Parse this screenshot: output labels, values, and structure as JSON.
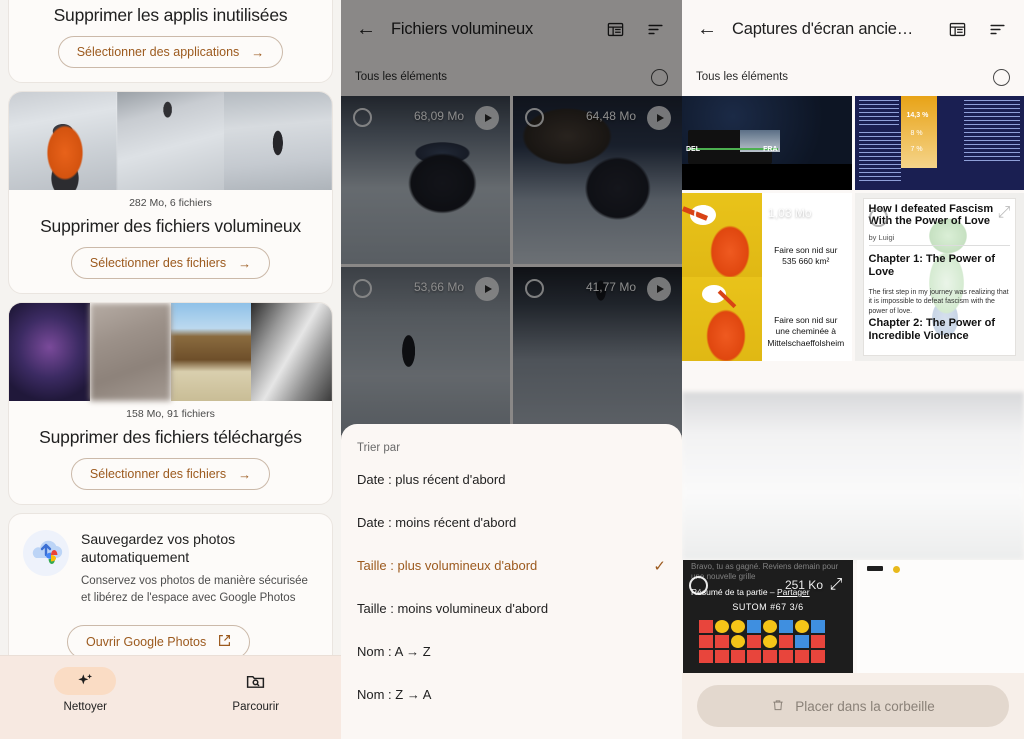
{
  "left_panel": {
    "cards": [
      {
        "title": "Supprimer les applis inutilisées",
        "button": "Sélectionner des applications",
        "arrow": "→"
      },
      {
        "meta": "282 Mo, 6 fichiers",
        "title": "Supprimer des fichiers volumineux",
        "button": "Sélectionner des fichiers",
        "arrow": "→"
      },
      {
        "meta": "158 Mo, 91 fichiers",
        "title": "Supprimer des fichiers téléchargés",
        "button": "Sélectionner des fichiers",
        "arrow": "→"
      }
    ],
    "promo": {
      "heading": "Sauvegardez vos photos automatiquement",
      "body": "Conservez vos photos de manière sécurisée et libérez de l'espace avec Google Photos",
      "button": "Ouvrir Google Photos",
      "button_icon": "external-link-icon"
    },
    "bottom_nav": [
      {
        "label": "Nettoyer",
        "icon": "sparkle-icon",
        "active": true
      },
      {
        "label": "Parcourir",
        "icon": "folder-search-icon",
        "active": false
      }
    ]
  },
  "middle_panel": {
    "title": "Fichiers volumineux",
    "back_icon": "arrow-left-icon",
    "view_icon": "list-view-icon",
    "sort_icon": "sort-icon",
    "select_all_label": "Tous les éléments",
    "items": [
      {
        "size": "68,09 Mo",
        "type": "video"
      },
      {
        "size": "64,48 Mo",
        "type": "video"
      },
      {
        "size": "53,66 Mo",
        "type": "video"
      },
      {
        "size": "41,77 Mo",
        "type": "video"
      }
    ],
    "sheet": {
      "title": "Trier par",
      "options": [
        {
          "label": "Date : plus récent d'abord",
          "selected": false
        },
        {
          "label": "Date : moins récent d'abord",
          "selected": false
        },
        {
          "label": "Taille : plus volumineux d'abord",
          "selected": true
        },
        {
          "label": "Taille : moins volumineux d'abord",
          "selected": false
        },
        {
          "label": "Nom : A → Z",
          "selected": false
        },
        {
          "label": "Nom : Z → A",
          "selected": false
        }
      ],
      "check_glyph": "✓"
    }
  },
  "right_panel": {
    "title": "Captures d'écran ancie…",
    "back_icon": "arrow-left-icon",
    "view_icon": "list-view-icon",
    "sort_icon": "sort-icon",
    "select_all_label": "Tous les éléments",
    "items": [
      {
        "size": "",
        "kind": "screenshot-flight-tracker"
      },
      {
        "size": "",
        "kind": "screenshot-infographic"
      },
      {
        "size": "1,03 Mo",
        "kind": "screenshot-stork-meme",
        "expand_icon": "expand-icon",
        "texts": [
          "Faire son nid sur 535 660 km²",
          "Faire son nid sur une cheminée à Mittelschaeffolsheim"
        ]
      },
      {
        "size": "",
        "kind": "screenshot-article",
        "expand_icon": "expand-icon",
        "texts": [
          "How I defeated Fascism With the Power of Love",
          "by Luigi",
          "Chapter 1: The Power of Love",
          "The first step in my journey was realizing that it is impossible to defeat fascism with the power of love.",
          "Chapter 2: The Power of Incredible Violence"
        ]
      },
      {
        "size": "",
        "kind": "screenshot-blurred"
      },
      {
        "size": "251 Ko",
        "kind": "screenshot-sutom",
        "expand_icon": "expand-icon",
        "texts": [
          "Bravo, tu as gagné. Reviens demain pour une nouvelle grille",
          "Résumé de ta partie –",
          "Partager",
          "SUTOM #67 3/6"
        ]
      }
    ],
    "trash_button": {
      "label": "Placer dans la corbeille",
      "icon": "trash-icon"
    }
  },
  "sutom_grid": {
    "rows": [
      [
        "red",
        "yellow",
        "yellow",
        "blue",
        "yellow",
        "blue",
        "yellow",
        "blue"
      ],
      [
        "red",
        "red",
        "yellow",
        "red",
        "yellow",
        "red",
        "blue",
        "red"
      ],
      [
        "red",
        "red",
        "red",
        "red",
        "red",
        "red",
        "red",
        "red"
      ]
    ],
    "colors": {
      "red": "#e8453c",
      "yellow": "#f5c518",
      "blue": "#3f8fe0",
      "bg": "#1d1d1d"
    }
  },
  "theme": {
    "accent": "#9c5a1e",
    "card_bg": "#fdfbf9",
    "page_bg": "#f5f3f0",
    "nav_bg": "#f7e9e1",
    "nav_pill": "#fadcc4"
  }
}
